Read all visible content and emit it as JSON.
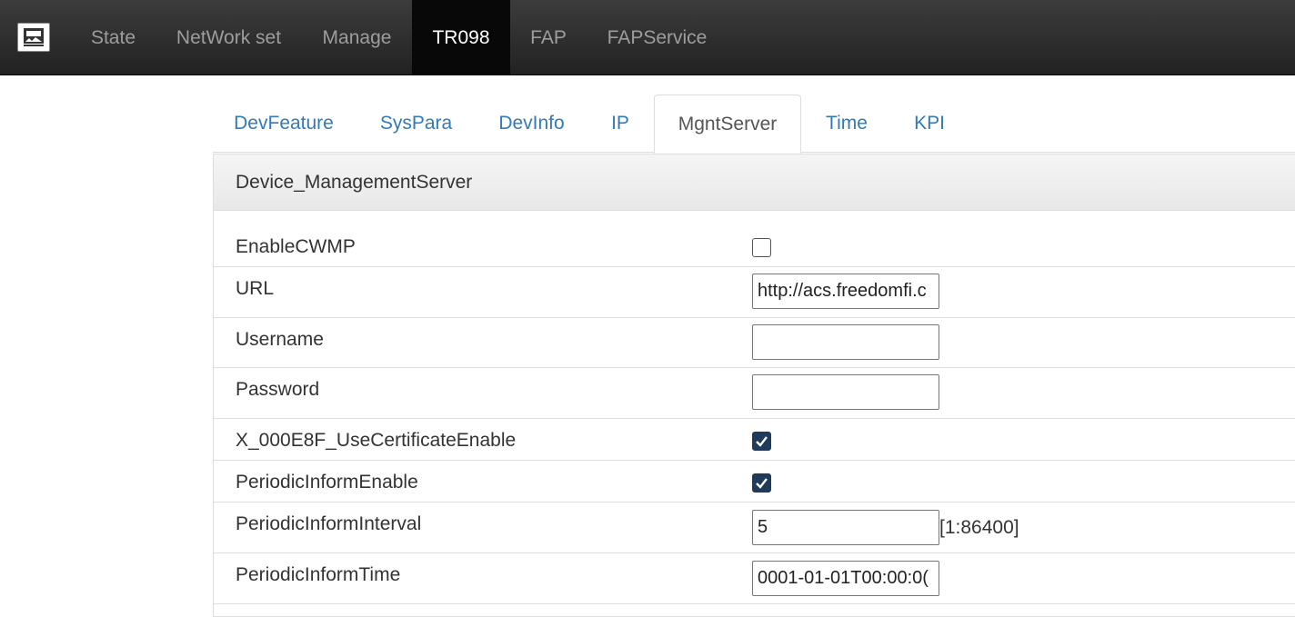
{
  "nav": {
    "items": [
      {
        "label": "State"
      },
      {
        "label": "NetWork set"
      },
      {
        "label": "Manage"
      },
      {
        "label": "TR098"
      },
      {
        "label": "FAP"
      },
      {
        "label": "FAPService"
      }
    ],
    "active": "TR098",
    "logo_icon": "router-logo-icon"
  },
  "tabs": {
    "items": [
      {
        "label": "DevFeature"
      },
      {
        "label": "SysPara"
      },
      {
        "label": "DevInfo"
      },
      {
        "label": "IP"
      },
      {
        "label": "MgntServer"
      },
      {
        "label": "Time"
      },
      {
        "label": "KPI"
      }
    ],
    "active": "MgntServer"
  },
  "panel": {
    "title": "Device_ManagementServer",
    "fields": {
      "enable_cwmp": {
        "label": "EnableCWMP",
        "checked": false
      },
      "url": {
        "label": "URL",
        "value": "http://acs.freedomfi.c"
      },
      "username": {
        "label": "Username",
        "value": ""
      },
      "password": {
        "label": "Password",
        "value": ""
      },
      "use_cert": {
        "label": "X_000E8F_UseCertificateEnable",
        "checked": true
      },
      "periodic_enable": {
        "label": "PeriodicInformEnable",
        "checked": true
      },
      "periodic_interval": {
        "label": "PeriodicInformInterval",
        "value": "5",
        "range": "[1:86400]"
      },
      "periodic_time": {
        "label": "PeriodicInformTime",
        "value": "0001-01-01T00:00:0("
      }
    }
  },
  "colors": {
    "navbar": "#222222",
    "nav_active": "#080808",
    "link": "#337ab7",
    "checkbox_checked": "#1f3a5a"
  }
}
